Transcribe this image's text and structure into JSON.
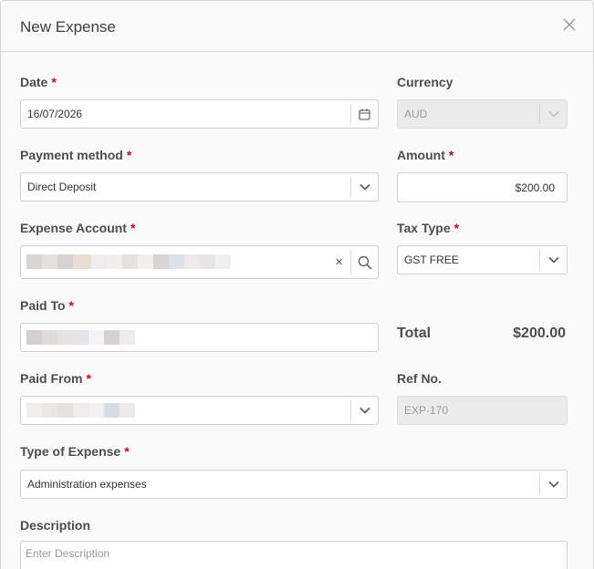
{
  "dialog": {
    "title": "New Expense",
    "close_icon": "close-icon"
  },
  "form": {
    "date": {
      "label": "Date",
      "required": "*",
      "value": "16/07/2026",
      "icon": "calendar-icon"
    },
    "currency": {
      "label": "Currency",
      "value": "AUD",
      "icon": "chevron-down-icon"
    },
    "payment_method": {
      "label": "Payment method",
      "required": "*",
      "value": "Direct Deposit",
      "icon": "chevron-down-icon"
    },
    "amount": {
      "label": "Amount",
      "required": "*",
      "value": "$200.00"
    },
    "expense_account": {
      "label": "Expense Account",
      "required": "*",
      "clear_glyph": "×",
      "icon": "search-icon"
    },
    "tax_type": {
      "label": "Tax Type",
      "required": "*",
      "value": "GST FREE",
      "icon": "chevron-down-icon"
    },
    "paid_to": {
      "label": "Paid To",
      "required": "*"
    },
    "total": {
      "label": "Total",
      "value": "$200.00"
    },
    "paid_from": {
      "label": "Paid From",
      "required": "*",
      "icon": "chevron-down-icon"
    },
    "ref_no": {
      "label": "Ref No.",
      "value": "EXP-170"
    },
    "type_of_expense": {
      "label": "Type of Expense",
      "required": "*",
      "value": "Administration expenses",
      "icon": "chevron-down-icon"
    },
    "description": {
      "label": "Description",
      "placeholder": "Enter Description"
    }
  },
  "colors": {
    "required": "#d0021b",
    "border": "#cfcfcf",
    "disabled_bg": "#ebebeb"
  }
}
